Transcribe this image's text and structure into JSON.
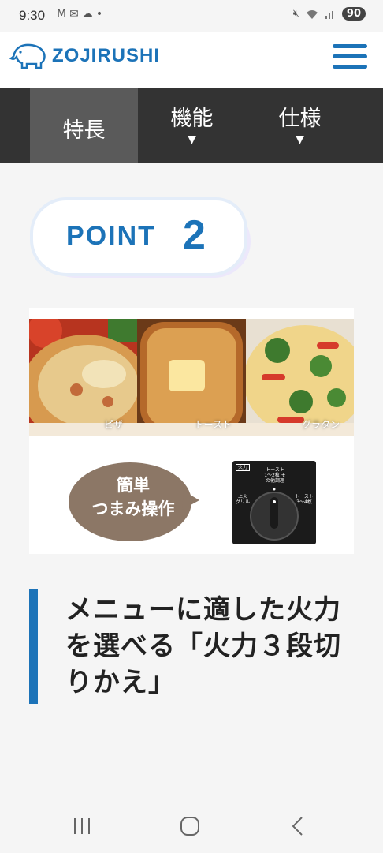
{
  "status_bar": {
    "time": "9:30",
    "battery": "90"
  },
  "header": {
    "brand": "ZOJIRUSHI"
  },
  "tabs": [
    {
      "label": "特長",
      "has_dropdown": false,
      "active": true
    },
    {
      "label": "機能",
      "has_dropdown": true,
      "active": false
    },
    {
      "label": "仕様",
      "has_dropdown": true,
      "active": false
    }
  ],
  "point": {
    "word": "POINT",
    "number": "2"
  },
  "feature_image": {
    "foods": [
      "ピザ",
      "トースト",
      "グラタン"
    ],
    "bubble_line1": "簡単",
    "bubble_line2": "つまみ操作",
    "dial_tags": [
      "火力",
      "トースト 1〜2枚 その他調理",
      "上火 グリル",
      "トースト 3〜4枚"
    ]
  },
  "headline": "メニューに適した火力を選べる「火力３段切りかえ」",
  "colors": {
    "brand_blue": "#1c73b8",
    "tab_bg": "#333333",
    "tab_active": "#5a5a5a",
    "bubble_brown": "#8c7766"
  }
}
